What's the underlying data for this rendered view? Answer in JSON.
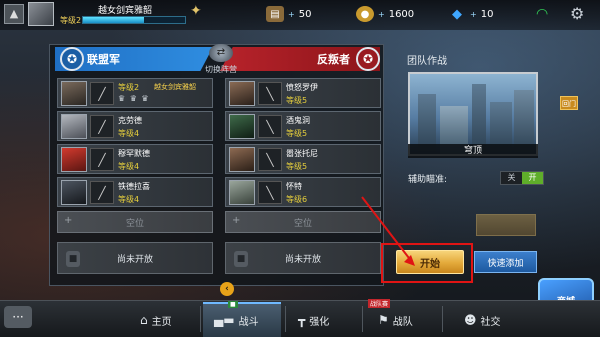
{
  "player": {
    "name": "越女剑宾雅韶",
    "level_label": "等级2",
    "xp_progress": 0.6
  },
  "resources": [
    {
      "icon": "ammo-crate-icon",
      "value": "50",
      "color": "#8a6a3a"
    },
    {
      "icon": "gold-coin-icon",
      "value": "1600",
      "color": "#c99a2e"
    },
    {
      "icon": "diamond-icon",
      "value": "10",
      "color": "#3fa7ff"
    }
  ],
  "teams": {
    "blue_name": "联盟军",
    "red_name": "反叛者",
    "switch_label": "切换阵营"
  },
  "blue_slots": [
    {
      "name": "越女剑宾雅韶",
      "level": "等级2",
      "badges": "♛ ♛ ♛"
    },
    {
      "name": "克劳德",
      "level": "等级4"
    },
    {
      "name": "穆罕默德",
      "level": "等级4"
    },
    {
      "name": "铁德拉喜",
      "level": "等级4"
    }
  ],
  "red_slots": [
    {
      "name": "愤怒罗伊",
      "level": "等级5"
    },
    {
      "name": "酒鬼洞",
      "level": "等级5"
    },
    {
      "name": "嚣张托尼",
      "level": "等级5"
    },
    {
      "name": "怀特",
      "level": "等级6"
    }
  ],
  "empty_slot_label": "空位",
  "locked_slot_label": "尚未开放",
  "right_panel": {
    "mode_label": "团队作战",
    "map_name": "穹顶",
    "map_tag": "回门",
    "assist_label": "辅助瞄准:",
    "toggle_off": "关",
    "toggle_on": "开"
  },
  "start_label": "开始",
  "quick_add_label": "快速添加",
  "shop_label": "商城",
  "nav": {
    "home": "主页",
    "battle": "战斗",
    "upgrade": "强化",
    "squad": "战队",
    "social": "社交",
    "battle_tag": "■",
    "squad_tag": "战队赛"
  },
  "accent_colors": {
    "blue_team": "#1f6fc4",
    "red_team": "#b8232b",
    "highlight": "#e01414"
  }
}
